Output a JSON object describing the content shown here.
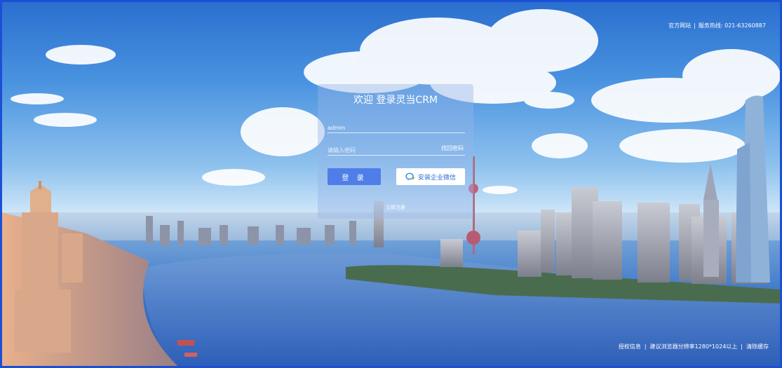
{
  "header": {
    "official_site": "官方网站",
    "separator": "|",
    "hotline": "服务热线: 021-63260887"
  },
  "login": {
    "title": "欢迎 登录灵当CRM",
    "username_value": "admin",
    "password_placeholder": "请输入密码",
    "forgot_password": "找回密码",
    "login_button": "登 录",
    "wechat_button": "安装企业微信",
    "register_link": "立即注册"
  },
  "footer": {
    "license": "授权信息",
    "separator": "|",
    "resolution_tip": "建议浏览器分辨率1280*1024以上",
    "clear_cache": "清除缓存"
  },
  "colors": {
    "accent": "#4f7ee8",
    "frame": "#1a4fd6",
    "wechat_text": "#2a6fd6"
  }
}
